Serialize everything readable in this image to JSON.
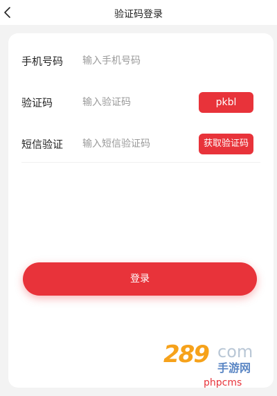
{
  "header": {
    "title": "验证码登录",
    "back_icon": "chevron-left-icon"
  },
  "form": {
    "phone": {
      "label": "手机号码",
      "placeholder": "输入手机号码",
      "value": ""
    },
    "captcha": {
      "label": "验证码",
      "placeholder": "输入验证码",
      "value": "",
      "captcha_text": "pkbl"
    },
    "sms": {
      "label": "短信验证",
      "placeholder": "输入短信验证码",
      "value": "",
      "button_label": "获取验证码"
    }
  },
  "login_button": {
    "label": "登录"
  },
  "watermark": {
    "logo": "289",
    "domain": "com",
    "subtitle": "手游网",
    "text": "phpcms"
  },
  "colors": {
    "accent": "#e8333a",
    "background": "#f3f3f3",
    "card": "#ffffff",
    "placeholder": "#9a9a9a"
  }
}
